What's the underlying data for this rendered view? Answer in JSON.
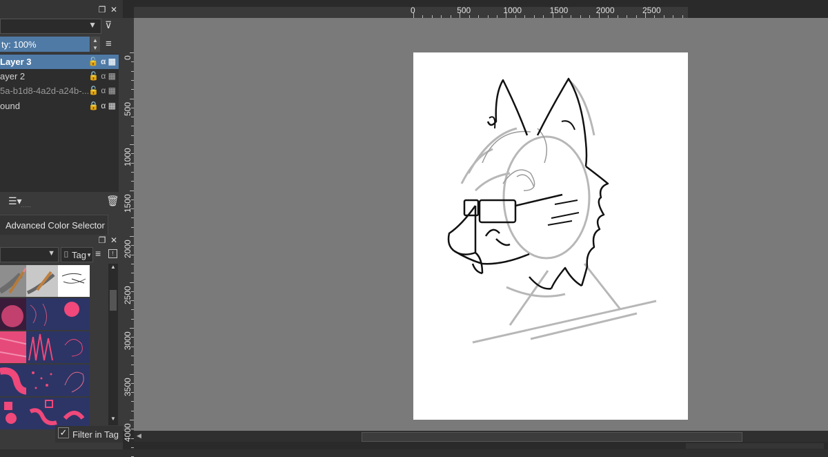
{
  "layers_panel": {
    "opacity_label": "ty:  100%",
    "layers": [
      {
        "name": "Layer 3",
        "active": true
      },
      {
        "name": "ayer 2",
        "active": false
      },
      {
        "name": "5a-b1d8-4a2d-a24b-...",
        "active": false
      },
      {
        "name": "ound",
        "active": false
      }
    ]
  },
  "color_selector_tab": "Advanced Color Selector",
  "brush_presets": {
    "tag_label": "Tag",
    "filter_label": "Filter in Tag",
    "filter_checked": true
  },
  "rulers": {
    "horizontal_labels": [
      "0",
      "500",
      "1000",
      "1500",
      "2000",
      "2500"
    ],
    "vertical_labels": [
      "0",
      "500",
      "1000",
      "1500",
      "2000",
      "2500",
      "3000",
      "3500",
      "4000"
    ]
  },
  "colors": {
    "accent": "#4f7aa6",
    "canvas_bg": "#7a7a7a",
    "paper": "#ffffff",
    "panel": "#3a3a3a",
    "brush_pink": "#f0487a",
    "brush_navy": "#2c3566"
  }
}
